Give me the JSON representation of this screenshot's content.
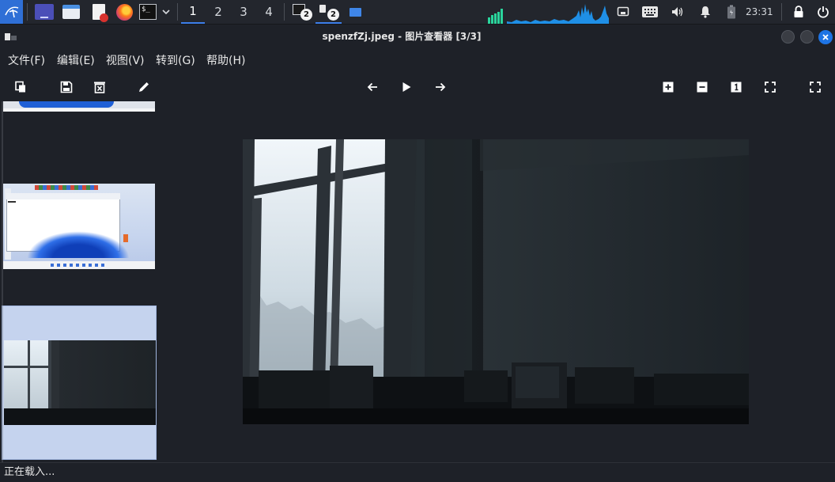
{
  "taskbar": {
    "workspaces": [
      "1",
      "2",
      "3",
      "4"
    ],
    "active_workspace": "1",
    "terminal_badge": "2",
    "viewer_badge": "2",
    "clock": "23:31",
    "icons": [
      "kali-menu-icon",
      "workspace-show-desktop-icon",
      "file-manager-icon",
      "text-editor-icon",
      "firefox-icon",
      "terminal-icon",
      "chevron-down-icon",
      "terminal-window-icon",
      "image-viewer-window-icon",
      "folder-window-icon",
      "network-icon",
      "keyboard-icon",
      "volume-icon",
      "notification-bell-icon",
      "battery-icon",
      "lock-icon",
      "power-icon"
    ]
  },
  "window": {
    "title": "spenzfZj.jpeg - 图片查看器 [3/3]"
  },
  "menu": {
    "file": "文件(F)",
    "edit": "编辑(E)",
    "view": "视图(V)",
    "goto": "转到(G)",
    "help": "帮助(H)"
  },
  "toolbar": {
    "left": [
      "copy-icon",
      "save-icon",
      "delete-icon",
      "edit-pencil-icon"
    ],
    "center": [
      "back-arrow-icon",
      "play-icon",
      "forward-arrow-icon"
    ],
    "right": [
      "zoom-in-icon",
      "zoom-out-icon",
      "actual-size-icon",
      "fit-window-icon",
      "fullscreen-icon"
    ]
  },
  "thumbnails": [
    {
      "name": "thumbnail-1",
      "selected": false
    },
    {
      "name": "thumbnail-2",
      "selected": false
    },
    {
      "name": "thumbnail-3",
      "selected": true
    }
  ],
  "status": {
    "text": "正在载入..."
  },
  "colors": {
    "accent": "#3d7ee9",
    "selection": "#c5d3ee",
    "background": "#1e2128",
    "taskbar": "#23262d",
    "close_button": "#1e74e4"
  }
}
